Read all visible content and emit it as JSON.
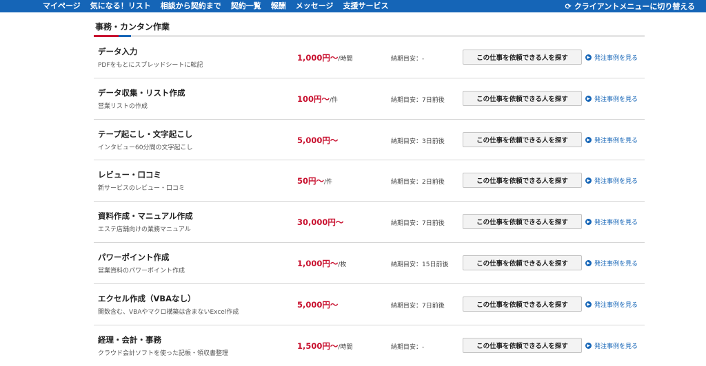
{
  "nav": {
    "items": [
      "マイページ",
      "気になる！リスト",
      "相談から契約まで",
      "契約一覧",
      "報酬",
      "メッセージ",
      "支援サービス"
    ],
    "switch_label": "クライアントメニューに切り替える",
    "color": "#1565b7"
  },
  "section": {
    "title": "事務・カンタン作業"
  },
  "common": {
    "find_button": "この仕事を依頼できる人を探す",
    "example_link": "発注事例を見る"
  },
  "rows": [
    {
      "name": "データ入力",
      "desc": "PDFをもとにスプレッドシートに転記",
      "price": "1,000円〜",
      "unit": "/時間",
      "deadline": "納期目安：-"
    },
    {
      "name": "データ収集・リスト作成",
      "desc": "営業リストの作成",
      "price": "100円〜",
      "unit": "/件",
      "deadline": "納期目安：7日前後"
    },
    {
      "name": "テープ起こし・文字起こし",
      "desc": "インタビュー60分間の文字起こし",
      "price": "5,000円〜",
      "unit": "",
      "deadline": "納期目安：3日前後"
    },
    {
      "name": "レビュー・口コミ",
      "desc": "新サービスのレビュー・口コミ",
      "price": "50円〜",
      "unit": "/件",
      "deadline": "納期目安：2日前後"
    },
    {
      "name": "資料作成・マニュアル作成",
      "desc": "エステ店舗向けの業務マニュアル",
      "price": "30,000円〜",
      "unit": "",
      "deadline": "納期目安：7日前後"
    },
    {
      "name": "パワーポイント作成",
      "desc": "営業資料のパワーポイント作成",
      "price": "1,000円〜",
      "unit": "/枚",
      "deadline": "納期目安：15日前後"
    },
    {
      "name": "エクセル作成（VBAなし）",
      "desc": "関数含む、VBAやマクロ構築は含まないExcel作成",
      "price": "5,000円〜",
      "unit": "",
      "deadline": "納期目安：7日前後"
    },
    {
      "name": "経理・会計・事務",
      "desc": "クラウド会計ソフトを使った記帳・領収書整理",
      "price": "1,500円〜",
      "unit": "/時間",
      "deadline": "納期目安：-"
    }
  ]
}
